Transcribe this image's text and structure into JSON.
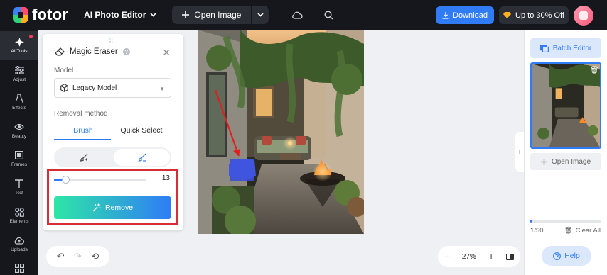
{
  "app": {
    "logo_text": "fotor",
    "product_name": "AI Photo Editor",
    "open_image_label": "Open Image",
    "download_label": "Download",
    "offer_label": "Up to 30% Off"
  },
  "colors": {
    "accent": "#2f7cf6",
    "topbar_bg": "#15171c",
    "highlight_box": "#d92d35"
  },
  "rail": {
    "items": [
      {
        "label": "AI Tools",
        "icon": "ai-tools-icon",
        "active": true
      },
      {
        "label": "Adjust",
        "icon": "adjust-icon"
      },
      {
        "label": "Effects",
        "icon": "effects-icon"
      },
      {
        "label": "Beauty",
        "icon": "beauty-icon"
      },
      {
        "label": "Frames",
        "icon": "frames-icon"
      },
      {
        "label": "Text",
        "icon": "text-icon"
      },
      {
        "label": "Elements",
        "icon": "elements-icon"
      },
      {
        "label": "Uploads",
        "icon": "uploads-icon"
      }
    ]
  },
  "panel": {
    "title": "Magic Eraser",
    "help_glyph": "?",
    "model_label": "Model",
    "model_value": "Legacy Model",
    "removal_label": "Removal method",
    "tabs": [
      "Brush",
      "Quick Select"
    ],
    "active_tab": 0,
    "brush_size": "13",
    "brush_fraction": 0.12,
    "remove_label": "Remove"
  },
  "canvas": {
    "zoom_label": "27%"
  },
  "right_panel": {
    "batch_editor_label": "Batch Editor",
    "open_image_label": "Open Image",
    "count_current": "1",
    "count_total": "/50",
    "clear_all_label": "Clear All",
    "progress_fraction": 0.02,
    "help_label": "Help"
  }
}
